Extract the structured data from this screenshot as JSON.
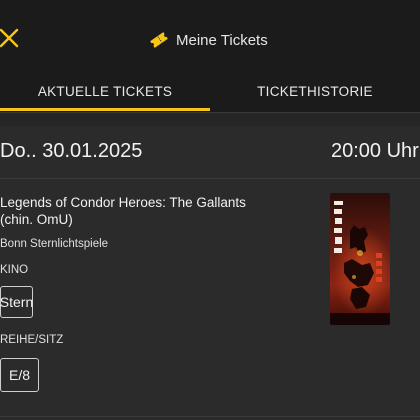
{
  "header": {
    "title": "Meine Tickets",
    "close_icon": "close-icon",
    "title_icon": "ticket-icon",
    "accent_color": "#f5c518"
  },
  "tabs": [
    {
      "label": "AKTUELLE TICKETS",
      "active": true
    },
    {
      "label": "TICKETHISTORIE",
      "active": false
    }
  ],
  "ticket": {
    "date": "Do.. 30.01.2025",
    "time": "20:00 Uhr",
    "movie_title": "Legends of Condor Heroes: The Gallants (chin. OmU)",
    "cinema": "Bonn Sternlichtspiele",
    "kino_label": "KINO",
    "kino_value": "Stern",
    "seat_label": "REIHE/SITZ",
    "seat_value": "E/8",
    "poster_icon": "movie-poster-image"
  }
}
